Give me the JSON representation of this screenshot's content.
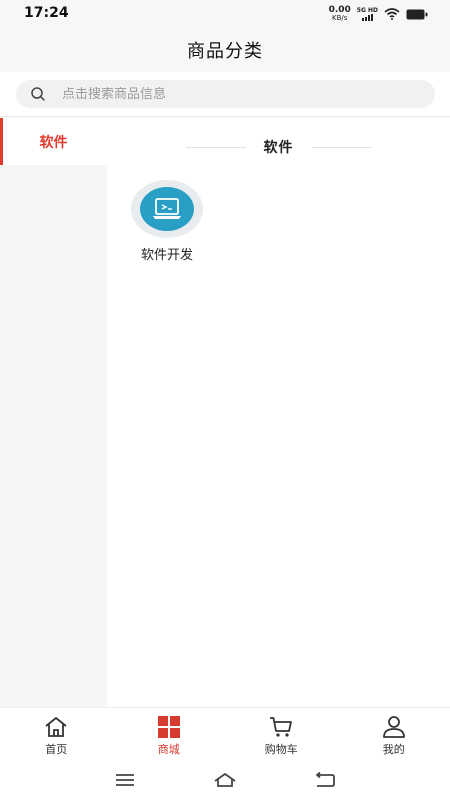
{
  "status_bar": {
    "time": "17:24",
    "net_speed_value": "0.00",
    "net_speed_unit": "KB/s",
    "signal_label": "5G HD"
  },
  "header": {
    "title": "商品分类"
  },
  "search": {
    "placeholder": "点击搜索商品信息",
    "value": ""
  },
  "sidebar": {
    "items": [
      {
        "label": "软件",
        "active": true
      }
    ]
  },
  "content": {
    "section_title": "软件",
    "products": [
      {
        "label": "软件开发",
        "icon": "laptop-icon"
      }
    ]
  },
  "tab_bar": {
    "tabs": [
      {
        "label": "首页",
        "icon": "home-icon",
        "active": false
      },
      {
        "label": "商城",
        "icon": "grid-icon",
        "active": true
      },
      {
        "label": "购物车",
        "icon": "cart-icon",
        "active": false
      },
      {
        "label": "我的",
        "icon": "user-icon",
        "active": false
      }
    ]
  },
  "colors": {
    "accent": "#d63b2f",
    "product_icon": "#2a9fc6"
  }
}
